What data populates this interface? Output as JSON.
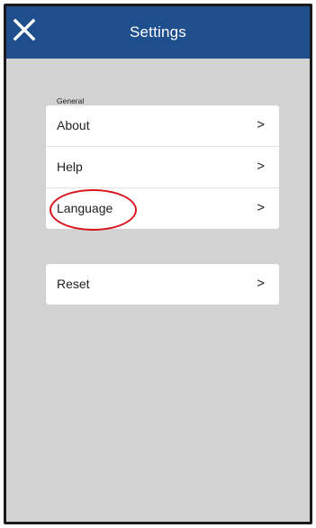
{
  "header": {
    "title": "Settings",
    "close_icon": "close-icon",
    "background_color": "#1f4e8c"
  },
  "sections": {
    "general_label": "General",
    "general_items": [
      {
        "label": "About",
        "chevron": ">"
      },
      {
        "label": "Help",
        "chevron": ">"
      },
      {
        "label": "Language",
        "chevron": ">"
      }
    ],
    "reset_item": {
      "label": "Reset",
      "chevron": ">"
    }
  },
  "annotation": {
    "highlight_color": "#d8141c",
    "highlighted_item": "Language"
  }
}
